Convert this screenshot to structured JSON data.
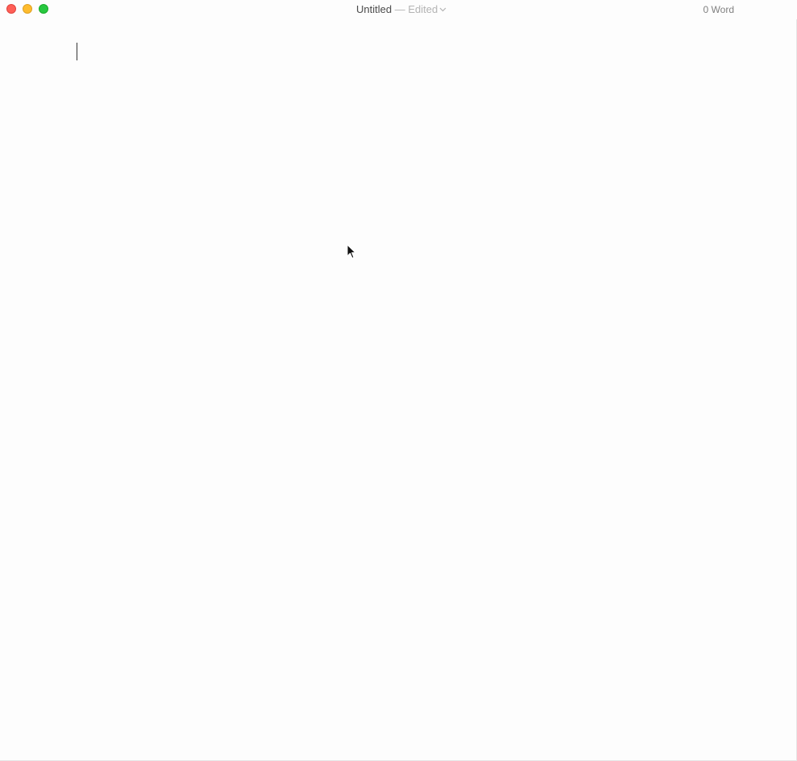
{
  "window": {
    "title": "Untitled",
    "separator": " — ",
    "status": "Edited",
    "word_count": "0 Word"
  },
  "editor": {
    "content": ""
  },
  "icons": {
    "close": "close-icon",
    "minimize": "minimize-icon",
    "zoom": "zoom-icon",
    "title_menu": "chevron-down-icon",
    "pointer": "mouse-pointer-icon"
  },
  "colors": {
    "close": "#ff5f57",
    "minimize": "#febc2e",
    "zoom": "#28c840",
    "background": "#fdfdfd"
  }
}
